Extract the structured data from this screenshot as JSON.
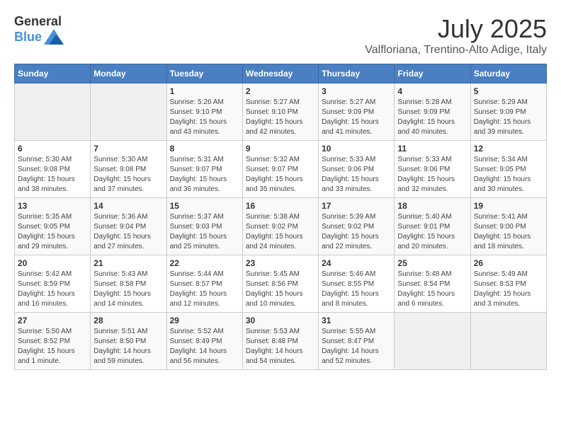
{
  "header": {
    "logo_general": "General",
    "logo_blue": "Blue",
    "title": "July 2025",
    "subtitle": "Valfloriana, Trentino-Alto Adige, Italy"
  },
  "calendar": {
    "days_of_week": [
      "Sunday",
      "Monday",
      "Tuesday",
      "Wednesday",
      "Thursday",
      "Friday",
      "Saturday"
    ],
    "weeks": [
      [
        {
          "day": "",
          "info": ""
        },
        {
          "day": "",
          "info": ""
        },
        {
          "day": "1",
          "info": "Sunrise: 5:26 AM\nSunset: 9:10 PM\nDaylight: 15 hours and 43 minutes."
        },
        {
          "day": "2",
          "info": "Sunrise: 5:27 AM\nSunset: 9:10 PM\nDaylight: 15 hours and 42 minutes."
        },
        {
          "day": "3",
          "info": "Sunrise: 5:27 AM\nSunset: 9:09 PM\nDaylight: 15 hours and 41 minutes."
        },
        {
          "day": "4",
          "info": "Sunrise: 5:28 AM\nSunset: 9:09 PM\nDaylight: 15 hours and 40 minutes."
        },
        {
          "day": "5",
          "info": "Sunrise: 5:29 AM\nSunset: 9:09 PM\nDaylight: 15 hours and 39 minutes."
        }
      ],
      [
        {
          "day": "6",
          "info": "Sunrise: 5:30 AM\nSunset: 9:08 PM\nDaylight: 15 hours and 38 minutes."
        },
        {
          "day": "7",
          "info": "Sunrise: 5:30 AM\nSunset: 9:08 PM\nDaylight: 15 hours and 37 minutes."
        },
        {
          "day": "8",
          "info": "Sunrise: 5:31 AM\nSunset: 9:07 PM\nDaylight: 15 hours and 36 minutes."
        },
        {
          "day": "9",
          "info": "Sunrise: 5:32 AM\nSunset: 9:07 PM\nDaylight: 15 hours and 35 minutes."
        },
        {
          "day": "10",
          "info": "Sunrise: 5:33 AM\nSunset: 9:06 PM\nDaylight: 15 hours and 33 minutes."
        },
        {
          "day": "11",
          "info": "Sunrise: 5:33 AM\nSunset: 9:06 PM\nDaylight: 15 hours and 32 minutes."
        },
        {
          "day": "12",
          "info": "Sunrise: 5:34 AM\nSunset: 9:05 PM\nDaylight: 15 hours and 30 minutes."
        }
      ],
      [
        {
          "day": "13",
          "info": "Sunrise: 5:35 AM\nSunset: 9:05 PM\nDaylight: 15 hours and 29 minutes."
        },
        {
          "day": "14",
          "info": "Sunrise: 5:36 AM\nSunset: 9:04 PM\nDaylight: 15 hours and 27 minutes."
        },
        {
          "day": "15",
          "info": "Sunrise: 5:37 AM\nSunset: 9:03 PM\nDaylight: 15 hours and 25 minutes."
        },
        {
          "day": "16",
          "info": "Sunrise: 5:38 AM\nSunset: 9:02 PM\nDaylight: 15 hours and 24 minutes."
        },
        {
          "day": "17",
          "info": "Sunrise: 5:39 AM\nSunset: 9:02 PM\nDaylight: 15 hours and 22 minutes."
        },
        {
          "day": "18",
          "info": "Sunrise: 5:40 AM\nSunset: 9:01 PM\nDaylight: 15 hours and 20 minutes."
        },
        {
          "day": "19",
          "info": "Sunrise: 5:41 AM\nSunset: 9:00 PM\nDaylight: 15 hours and 18 minutes."
        }
      ],
      [
        {
          "day": "20",
          "info": "Sunrise: 5:42 AM\nSunset: 8:59 PM\nDaylight: 15 hours and 16 minutes."
        },
        {
          "day": "21",
          "info": "Sunrise: 5:43 AM\nSunset: 8:58 PM\nDaylight: 15 hours and 14 minutes."
        },
        {
          "day": "22",
          "info": "Sunrise: 5:44 AM\nSunset: 8:57 PM\nDaylight: 15 hours and 12 minutes."
        },
        {
          "day": "23",
          "info": "Sunrise: 5:45 AM\nSunset: 8:56 PM\nDaylight: 15 hours and 10 minutes."
        },
        {
          "day": "24",
          "info": "Sunrise: 5:46 AM\nSunset: 8:55 PM\nDaylight: 15 hours and 8 minutes."
        },
        {
          "day": "25",
          "info": "Sunrise: 5:48 AM\nSunset: 8:54 PM\nDaylight: 15 hours and 6 minutes."
        },
        {
          "day": "26",
          "info": "Sunrise: 5:49 AM\nSunset: 8:53 PM\nDaylight: 15 hours and 3 minutes."
        }
      ],
      [
        {
          "day": "27",
          "info": "Sunrise: 5:50 AM\nSunset: 8:52 PM\nDaylight: 15 hours and 1 minute."
        },
        {
          "day": "28",
          "info": "Sunrise: 5:51 AM\nSunset: 8:50 PM\nDaylight: 14 hours and 59 minutes."
        },
        {
          "day": "29",
          "info": "Sunrise: 5:52 AM\nSunset: 8:49 PM\nDaylight: 14 hours and 56 minutes."
        },
        {
          "day": "30",
          "info": "Sunrise: 5:53 AM\nSunset: 8:48 PM\nDaylight: 14 hours and 54 minutes."
        },
        {
          "day": "31",
          "info": "Sunrise: 5:55 AM\nSunset: 8:47 PM\nDaylight: 14 hours and 52 minutes."
        },
        {
          "day": "",
          "info": ""
        },
        {
          "day": "",
          "info": ""
        }
      ]
    ]
  }
}
